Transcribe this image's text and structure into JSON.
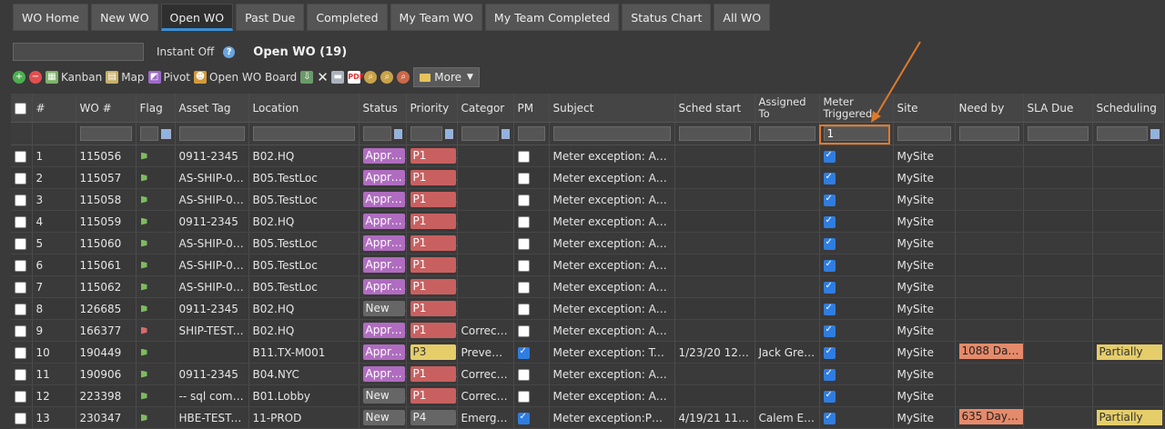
{
  "tabs": [
    {
      "label": "WO Home",
      "active": false
    },
    {
      "label": "New WO",
      "active": false
    },
    {
      "label": "Open WO",
      "active": true
    },
    {
      "label": "Past Due",
      "active": false
    },
    {
      "label": "Completed",
      "active": false
    },
    {
      "label": "My Team WO",
      "active": false
    },
    {
      "label": "My Team Completed",
      "active": false
    },
    {
      "label": "Status Chart",
      "active": false
    },
    {
      "label": "All WO",
      "active": false
    }
  ],
  "search": {
    "value": "",
    "instant_label": "Instant Off",
    "view_title": "Open WO (19)"
  },
  "toolbar": {
    "kanban": "Kanban",
    "map": "Map",
    "pivot": "Pivot",
    "board": "Open WO Board",
    "more": "More"
  },
  "columns": {
    "num": "#",
    "wo": "WO #",
    "flag": "Flag",
    "asset": "Asset Tag",
    "location": "Location",
    "status": "Status",
    "priority": "Priority",
    "category": "Categor",
    "pm": "PM",
    "subject": "Subject",
    "sched": "Sched start",
    "assigned": "Assigned To",
    "meter": "Meter Triggered",
    "site": "Site",
    "needby": "Need by",
    "sla": "SLA Due",
    "scheduling": "Scheduling"
  },
  "filters": {
    "meter": "1"
  },
  "rows": [
    {
      "n": "1",
      "wo": "115056",
      "flag": "green",
      "asset": "0911-2345",
      "loc": "B02.HQ",
      "status": "Appro...",
      "st": "appro",
      "pri": "P1",
      "cat": "",
      "pm": false,
      "subject": "Meter exception: AMP-...",
      "sched": "",
      "assigned": "",
      "meter": true,
      "site": "MySite",
      "needby": "",
      "sla": "",
      "scheduling": ""
    },
    {
      "n": "2",
      "wo": "115057",
      "flag": "green",
      "asset": "AS-SHIP-01_...",
      "loc": "B05.TestLoc",
      "status": "Appro...",
      "st": "appro",
      "pri": "P1",
      "cat": "",
      "pm": false,
      "subject": "Meter exception: AMP-...",
      "sched": "",
      "assigned": "",
      "meter": true,
      "site": "MySite",
      "needby": "",
      "sla": "",
      "scheduling": ""
    },
    {
      "n": "3",
      "wo": "115058",
      "flag": "green",
      "asset": "AS-SHIP-01_...",
      "loc": "B05.TestLoc",
      "status": "Appro...",
      "st": "appro",
      "pri": "P1",
      "cat": "",
      "pm": false,
      "subject": "Meter exception: AMP-...",
      "sched": "",
      "assigned": "",
      "meter": true,
      "site": "MySite",
      "needby": "",
      "sla": "",
      "scheduling": ""
    },
    {
      "n": "4",
      "wo": "115059",
      "flag": "green",
      "asset": "0911-2345",
      "loc": "B02.HQ",
      "status": "Appro...",
      "st": "appro",
      "pri": "P1",
      "cat": "",
      "pm": false,
      "subject": "Meter exception: AMP-...",
      "sched": "",
      "assigned": "",
      "meter": true,
      "site": "MySite",
      "needby": "",
      "sla": "",
      "scheduling": ""
    },
    {
      "n": "5",
      "wo": "115060",
      "flag": "green",
      "asset": "AS-SHIP-01_...",
      "loc": "B05.TestLoc",
      "status": "Appro...",
      "st": "appro",
      "pri": "P1",
      "cat": "",
      "pm": false,
      "subject": "Meter exception: AMP-...",
      "sched": "",
      "assigned": "",
      "meter": true,
      "site": "MySite",
      "needby": "",
      "sla": "",
      "scheduling": ""
    },
    {
      "n": "6",
      "wo": "115061",
      "flag": "green",
      "asset": "AS-SHIP-01_...",
      "loc": "B05.TestLoc",
      "status": "Appro...",
      "st": "appro",
      "pri": "P1",
      "cat": "",
      "pm": false,
      "subject": "Meter exception: AMP-...",
      "sched": "",
      "assigned": "",
      "meter": true,
      "site": "MySite",
      "needby": "",
      "sla": "",
      "scheduling": ""
    },
    {
      "n": "7",
      "wo": "115062",
      "flag": "green",
      "asset": "AS-SHIP-01_...",
      "loc": "B05.TestLoc",
      "status": "Appro...",
      "st": "appro",
      "pri": "P1",
      "cat": "",
      "pm": false,
      "subject": "Meter exception: AMP-...",
      "sched": "",
      "assigned": "",
      "meter": true,
      "site": "MySite",
      "needby": "",
      "sla": "",
      "scheduling": ""
    },
    {
      "n": "8",
      "wo": "126685",
      "flag": "green",
      "asset": "0911-2345",
      "loc": "B02.HQ",
      "status": "New",
      "st": "new",
      "pri": "P1",
      "cat": "",
      "pm": false,
      "subject": "Meter exception: AMP-...",
      "sched": "",
      "assigned": "",
      "meter": true,
      "site": "MySite",
      "needby": "",
      "sla": "",
      "scheduling": ""
    },
    {
      "n": "9",
      "wo": "166377",
      "flag": "red",
      "asset": "SHIP-TEST-0...",
      "loc": "B02.HQ",
      "status": "Appro...",
      "st": "appro",
      "pri": "P1",
      "cat": "Corrective",
      "pm": false,
      "subject": "Meter exception: AMP-...",
      "sched": "",
      "assigned": "",
      "meter": true,
      "site": "MySite",
      "needby": "",
      "sla": "",
      "scheduling": ""
    },
    {
      "n": "10",
      "wo": "190449",
      "flag": "green",
      "asset": "",
      "loc": "B11.TX-M001",
      "status": "Appro...",
      "st": "appro",
      "pri": "P3",
      "cat": "Preventive",
      "pm": true,
      "subject": "Meter exception: Test ...",
      "sched": "1/23/20 12:0...",
      "assigned": "Jack Greener",
      "meter": true,
      "site": "MySite",
      "needby": "1088 Days ...",
      "sla": "",
      "scheduling": "Partially"
    },
    {
      "n": "11",
      "wo": "190906",
      "flag": "green",
      "asset": "0911-2345",
      "loc": "B04.NYC",
      "status": "Appro...",
      "st": "appro",
      "pri": "P1",
      "cat": "Corrective",
      "pm": false,
      "subject": "Meter exception: AMP-...",
      "sched": "",
      "assigned": "",
      "meter": true,
      "site": "MySite",
      "needby": "",
      "sla": "",
      "scheduling": ""
    },
    {
      "n": "12",
      "wo": "223398",
      "flag": "green",
      "asset": "-- sql comm...",
      "loc": "B01.Lobby",
      "status": "New",
      "st": "new",
      "pri": "P1",
      "cat": "Corrective",
      "pm": false,
      "subject": "Meter exception: AMP-...",
      "sched": "",
      "assigned": "",
      "meter": true,
      "site": "MySite",
      "needby": "",
      "sla": "",
      "scheduling": ""
    },
    {
      "n": "13",
      "wo": "230347",
      "flag": "green",
      "asset": "HBE-TEST-003",
      "loc": "11-PROD",
      "status": "New",
      "st": "new",
      "pri": "P4",
      "cat": "Emergency",
      "pm": true,
      "subject": "Meter exception:PM_W...",
      "sched": "4/19/21 11:0...",
      "assigned": "Calem Eam",
      "meter": true,
      "site": "MySite",
      "needby": "635 Days ...",
      "sla": "",
      "scheduling": "Partially"
    }
  ]
}
